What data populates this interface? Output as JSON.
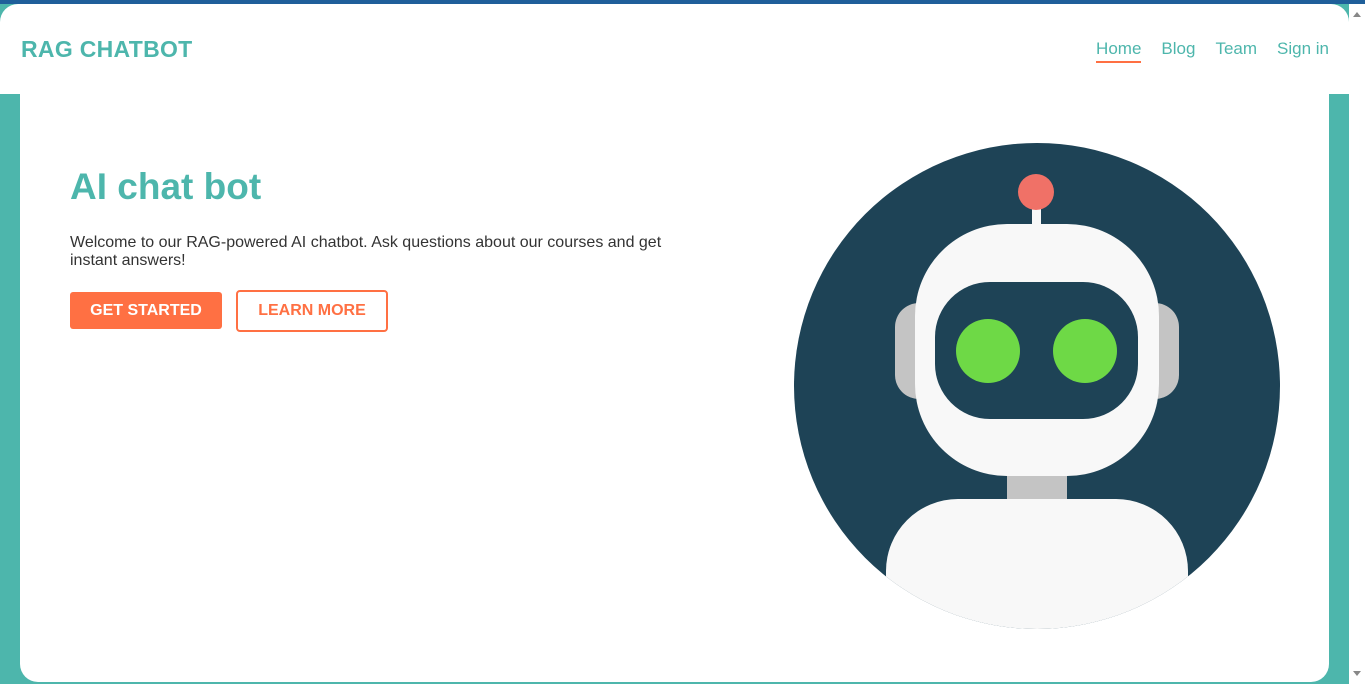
{
  "header": {
    "logo": "RAG CHATBOT",
    "nav": [
      {
        "label": "Home",
        "active": true
      },
      {
        "label": "Blog",
        "active": false
      },
      {
        "label": "Team",
        "active": false
      },
      {
        "label": "Sign in",
        "active": false
      }
    ]
  },
  "hero": {
    "title": "AI chat bot",
    "description": "Welcome to our RAG-powered AI chatbot. Ask questions about our courses and get instant answers!",
    "primary_button": "GET STARTED",
    "secondary_button": "LEARN MORE"
  },
  "illustration": {
    "icon": "robot-icon",
    "colors": {
      "background": "#1e4356",
      "body": "#f8f8f8",
      "eyes": "#6ed946",
      "antenna_tip": "#f07167",
      "ears": "#c4c4c4"
    }
  },
  "theme": {
    "accent": "#4db6ac",
    "cta": "#ff7043"
  }
}
